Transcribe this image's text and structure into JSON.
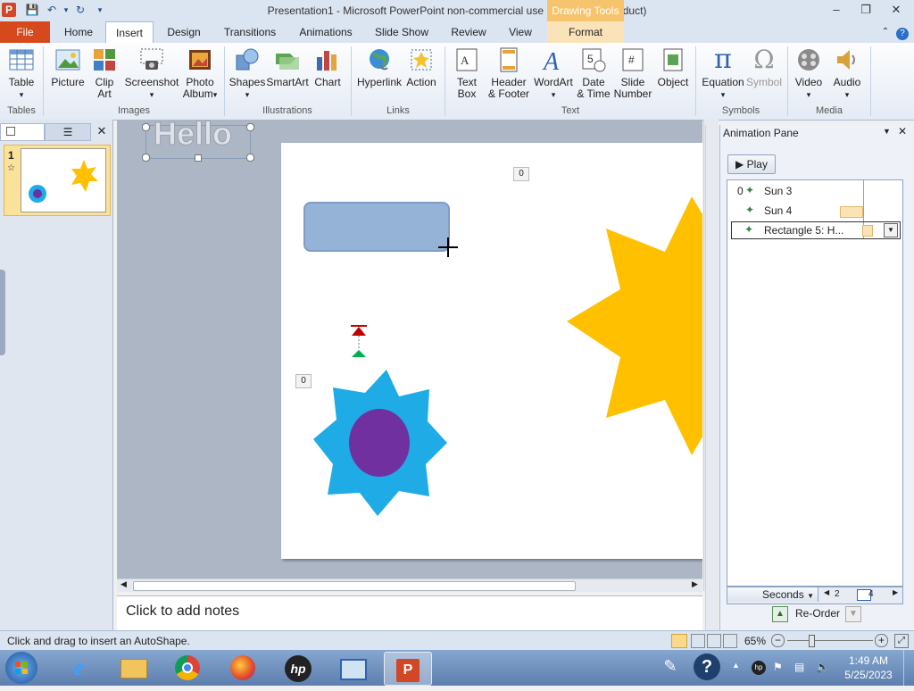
{
  "window": {
    "title": "Presentation1  -  Microsoft PowerPoint non-commercial use (Unlicensed Product)",
    "contextual_tab_group": "Drawing Tools",
    "app_icon": "P",
    "controls": {
      "minimize": "–",
      "restore": "❐",
      "close": "✕"
    }
  },
  "tabs": [
    {
      "label": "File"
    },
    {
      "label": "Home"
    },
    {
      "label": "Insert"
    },
    {
      "label": "Design"
    },
    {
      "label": "Transitions"
    },
    {
      "label": "Animations"
    },
    {
      "label": "Slide Show"
    },
    {
      "label": "Review"
    },
    {
      "label": "View"
    },
    {
      "label": "Format"
    }
  ],
  "ribbon": {
    "buttons": {
      "table": "Table",
      "picture": "Picture",
      "clip_art_1": "Clip",
      "clip_art_2": "Art",
      "screenshot": "Screenshot",
      "photo_album_1": "Photo",
      "photo_album_2": "Album",
      "shapes": "Shapes",
      "smartart": "SmartArt",
      "chart": "Chart",
      "hyperlink": "Hyperlink",
      "action": "Action",
      "textbox_1": "Text",
      "textbox_2": "Box",
      "header_footer_1": "Header",
      "header_footer_2": "& Footer",
      "wordart": "WordArt",
      "date_time_1": "Date",
      "date_time_2": "& Time",
      "slide_number_1": "Slide",
      "slide_number_2": "Number",
      "object": "Object",
      "equation": "Equation",
      "symbol": "Symbol",
      "video": "Video",
      "audio": "Audio"
    },
    "groups": {
      "tables": "Tables",
      "images": "Images",
      "illustrations": "Illustrations",
      "links": "Links",
      "text": "Text",
      "symbols": "Symbols",
      "media": "Media"
    },
    "symbol_glyphs": {
      "equation": "π",
      "symbol": "Ω"
    }
  },
  "thumbnails": {
    "slide_number": "1"
  },
  "slide": {
    "wordart_text": "Hello",
    "anim_tag_top": "0",
    "anim_tag_left": "0",
    "colors": {
      "rectangle": "#95b3d7",
      "sun_large": "#ffc000",
      "sun_small": "#1eabe6",
      "sun_center": "#7030a0"
    }
  },
  "notes": {
    "placeholder": "Click to add notes"
  },
  "animation_pane": {
    "title": "Animation Pane",
    "play_label": "Play",
    "items": [
      {
        "index": "0",
        "label": "Sun 3"
      },
      {
        "index": "",
        "label": "Sun 4"
      },
      {
        "index": "",
        "label": "Rectangle 5: H..."
      }
    ],
    "timeline": {
      "unit": "Seconds",
      "tick_1": "2",
      "tick_2": "4"
    },
    "reorder_label": "Re-Order"
  },
  "status": {
    "hint": "Click and drag to insert an AutoShape.",
    "zoom": "65%"
  },
  "taskbar": {
    "clock_time": "1:49 AM",
    "clock_date": "5/25/2023"
  }
}
